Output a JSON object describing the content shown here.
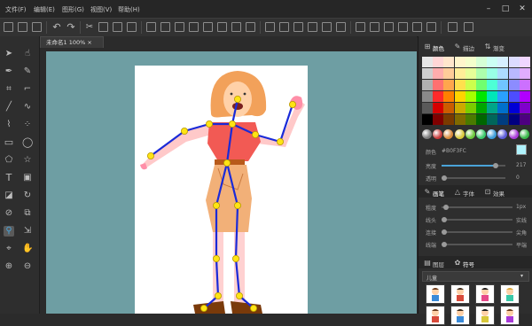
{
  "menubar": {
    "items": [
      "文件(F)",
      "编辑(E)",
      "图形(G)",
      "视图(V)",
      "帮助(H)"
    ]
  },
  "document": {
    "tab_label": "未命名1  100% ×"
  },
  "right_panel": {
    "top_tabs": [
      "颜色",
      "描边",
      "渐变"
    ],
    "color_label": "颜色",
    "color_value": "#B0F3FC",
    "brightness_label": "亮度",
    "brightness_value": "217",
    "brightness_level": 0.85,
    "opacity_label": "透明",
    "opacity_value": "0",
    "opacity_level": 0.0,
    "stroke_tabs": [
      "画笔",
      "字体",
      "效果"
    ],
    "stroke_rows": [
      {
        "label": "粗度",
        "value": "1px"
      },
      {
        "label": "线头",
        "value": "实线"
      },
      {
        "label": "连接",
        "value": "尖角"
      },
      {
        "label": "线端",
        "value": "平端"
      }
    ],
    "layer_tabs": [
      "图层",
      "符号"
    ],
    "symbol_category": "儿童"
  },
  "colors": {
    "canvas_bg": "#6e9ea3",
    "accent": "#4aa3d8",
    "bone": "#1a2ad8",
    "joint": "#ffe414"
  },
  "palette": [
    [
      "#e6e6e6",
      "#ffd6d6",
      "#ffe6cc",
      "#fff6cc",
      "#f4ffcc",
      "#d6ffd6",
      "#ccfff4",
      "#d6f0ff",
      "#dcdcff",
      "#f0d6ff"
    ],
    [
      "#cfcfcf",
      "#ffadad",
      "#ffcc99",
      "#ffee99",
      "#e6ff99",
      "#adffad",
      "#99ffe6",
      "#addcff",
      "#b9b9ff",
      "#e0adff"
    ],
    [
      "#b0b0b0",
      "#ff7070",
      "#ffa64d",
      "#ffe04d",
      "#ccff4d",
      "#70ff70",
      "#4dffd6",
      "#70c4ff",
      "#8c8cff",
      "#cc70ff"
    ],
    [
      "#8a8a8a",
      "#ff2a2a",
      "#ff8000",
      "#ffd400",
      "#a6ff00",
      "#00e600",
      "#00e6b8",
      "#2aa0ff",
      "#4d4dff",
      "#b000ff"
    ],
    [
      "#5a5a5a",
      "#d60000",
      "#cc5c00",
      "#ccaa00",
      "#7acc00",
      "#00a600",
      "#00a688",
      "#0070cc",
      "#0000d6",
      "#8000cc"
    ],
    [
      "#000000",
      "#800000",
      "#7a3a00",
      "#806a00",
      "#4a7a00",
      "#006600",
      "#00665a",
      "#003d80",
      "#000080",
      "#4d0080"
    ]
  ],
  "balls": [
    "#7a7a7a",
    "#c83a3a",
    "#d88a3a",
    "#d8c83a",
    "#6ac83a",
    "#3ac86a",
    "#3a9ad8",
    "#5a5ad8",
    "#a83ad8",
    "#38b848"
  ]
}
